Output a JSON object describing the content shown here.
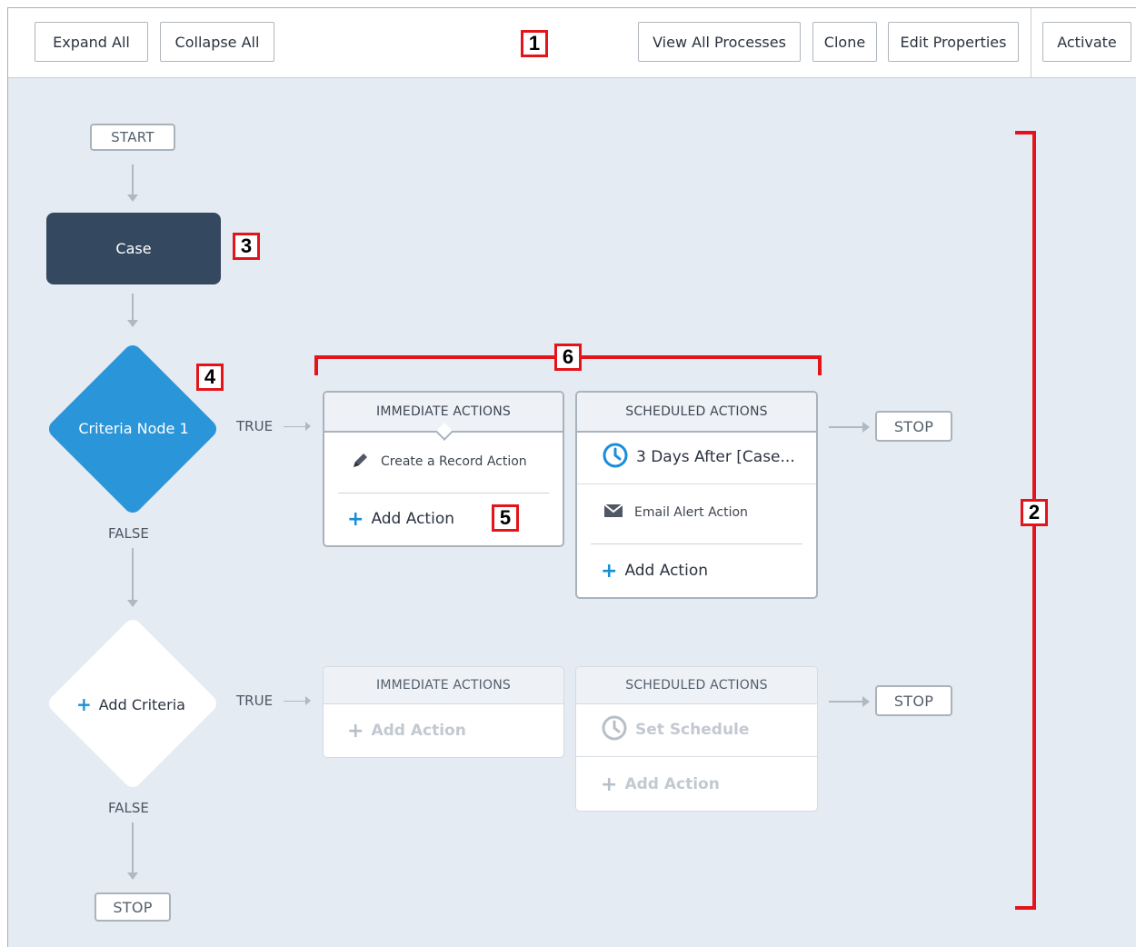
{
  "toolbar": {
    "expand_all": "Expand All",
    "collapse_all": "Collapse All",
    "view_all_processes": "View All Processes",
    "clone": "Clone",
    "edit_properties": "Edit Properties",
    "activate": "Activate"
  },
  "flow": {
    "start": "START",
    "object_node": "Case",
    "criteria1": {
      "label": "Criteria Node 1",
      "true_label": "TRUE",
      "false_label": "FALSE",
      "immediate_header": "IMMEDIATE ACTIONS",
      "immediate_action": "Create a Record Action",
      "immediate_add": "Add Action",
      "scheduled_header": "SCHEDULED ACTIONS",
      "schedule": "3 Days After [Case...",
      "scheduled_action": "Email Alert Action",
      "scheduled_add": "Add Action",
      "stop": "STOP"
    },
    "criteria2": {
      "label": "Add Criteria",
      "true_label": "TRUE",
      "false_label": "FALSE",
      "immediate_header": "IMMEDIATE ACTIONS",
      "immediate_add": "Add Action",
      "scheduled_header": "SCHEDULED ACTIONS",
      "set_schedule": "Set Schedule",
      "scheduled_add": "Add Action",
      "stop": "STOP"
    },
    "final_stop": "STOP"
  },
  "annotations": {
    "a1": "1",
    "a2": "2",
    "a3": "3",
    "a4": "4",
    "a5": "5",
    "a6": "6"
  },
  "colors": {
    "object_node": "#344860",
    "criteria_node": "#2a95d8",
    "add_icon": "#1b8ed8",
    "annotation": "#e4141b"
  }
}
